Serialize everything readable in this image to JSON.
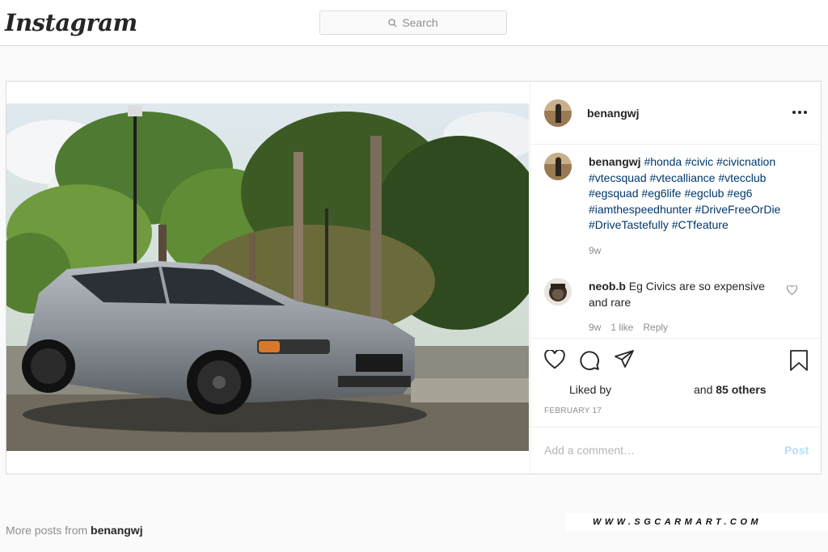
{
  "header": {
    "logo": "Instagram",
    "search_placeholder": "Search"
  },
  "post": {
    "author": "benangwj",
    "caption": {
      "username": "benangwj",
      "text_parts": [
        "#honda",
        "#civic",
        "#civicnation",
        "#vtecsquad",
        "#vtecalliance",
        "#vtecclub",
        "#egsquad",
        "#eg6life",
        "#egclub",
        "#eg6",
        "#iamthespeedhunter",
        "#DriveFreeOrDie",
        "#DriveTastefully",
        "#CTfeature"
      ],
      "time": "9w"
    },
    "comment": {
      "username": "neob.b",
      "text": "Eg Civics are so expensive and rare",
      "time": "9w",
      "likes": "1 like",
      "reply": "Reply"
    },
    "likes": {
      "prefix": "Liked by",
      "suffix_and": "and",
      "others": "85 others"
    },
    "date": "FEBRUARY 17",
    "add_comment_placeholder": "Add a comment…",
    "post_button": "Post"
  },
  "footer": {
    "more_posts_prefix": "More posts from",
    "more_posts_user": "benangwj",
    "watermark": "WWW.SGCARMART.COM"
  },
  "icons": {
    "search": "search-icon",
    "more": "more-options-icon",
    "heart": "heart-icon",
    "comment": "comment-icon",
    "share": "share-icon",
    "save": "bookmark-icon"
  }
}
